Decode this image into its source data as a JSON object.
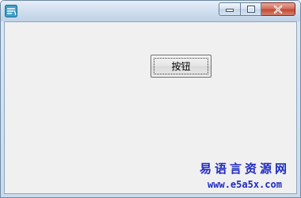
{
  "window": {
    "title": "",
    "buttons": {
      "minimize": "minimize",
      "maximize": "maximize",
      "close": "close"
    }
  },
  "form": {
    "button_label": "按钮"
  },
  "watermark": {
    "title": "易语言资源网",
    "url": "www.e5a5x.com"
  },
  "colors": {
    "client_bg": "#f0f0f0",
    "close_button": "#c04a35",
    "watermark_text": "#1f2ac2"
  }
}
